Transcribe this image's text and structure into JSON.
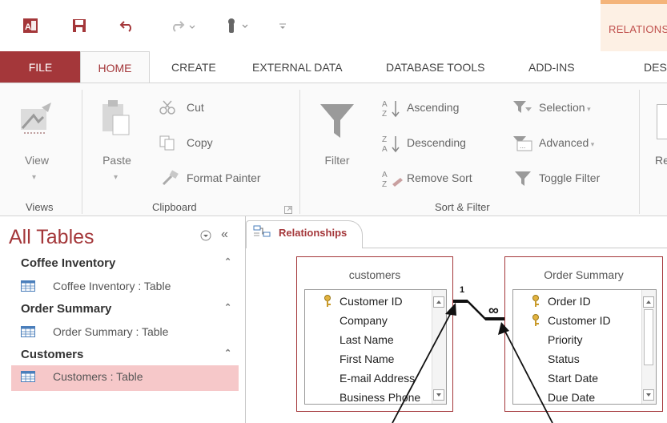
{
  "quick_access": {
    "icons": [
      "access-app-icon",
      "save-icon",
      "undo-icon",
      "redo-icon",
      "touch-mode-icon",
      "customize-qat-icon"
    ]
  },
  "context_tab": {
    "label": "RELATIONS"
  },
  "ribbon_tabs": {
    "file": "FILE",
    "home": "HOME",
    "create": "CREATE",
    "external_data": "EXTERNAL DATA",
    "database_tools": "DATABASE TOOLS",
    "add_ins": "ADD-INS",
    "design": "DES"
  },
  "ribbon": {
    "views": {
      "view_label": "View",
      "group": "Views"
    },
    "clipboard": {
      "paste_label": "Paste",
      "cut": "Cut",
      "copy": "Copy",
      "format_painter": "Format Painter",
      "group": "Clipboard"
    },
    "sort_filter": {
      "filter": "Filter",
      "ascending": "Ascending",
      "descending": "Descending",
      "remove_sort": "Remove Sort",
      "selection": "Selection",
      "advanced": "Advanced",
      "toggle_filter": "Toggle Filter",
      "group": "Sort & Filter"
    },
    "records": {
      "label_partial": "Re"
    }
  },
  "nav_pane": {
    "title": "All Tables",
    "groups": [
      {
        "header": "Coffee Inventory",
        "item": "Coffee Inventory : Table"
      },
      {
        "header": "Order Summary",
        "item": "Order Summary : Table"
      },
      {
        "header": "Customers",
        "item": "Customers : Table",
        "selected": true
      }
    ]
  },
  "document_tab": {
    "label": "Relationships"
  },
  "relationships": {
    "customers": {
      "title": "customers",
      "fields": [
        "Customer ID",
        "Company",
        "Last Name",
        "First Name",
        "E-mail Address",
        "Business Phone"
      ],
      "key_fields": [
        "Customer ID"
      ]
    },
    "order_summary": {
      "title": "Order Summary",
      "fields": [
        "Order ID",
        "Customer ID",
        "Priority",
        "Status",
        "Start Date",
        "Due Date"
      ],
      "key_fields": [
        "Order ID",
        "Customer ID"
      ]
    },
    "join": {
      "one_side": "1",
      "many_side": "∞"
    }
  },
  "colors": {
    "accent": "#a4373a",
    "selected_row": "#f6c8c9"
  }
}
